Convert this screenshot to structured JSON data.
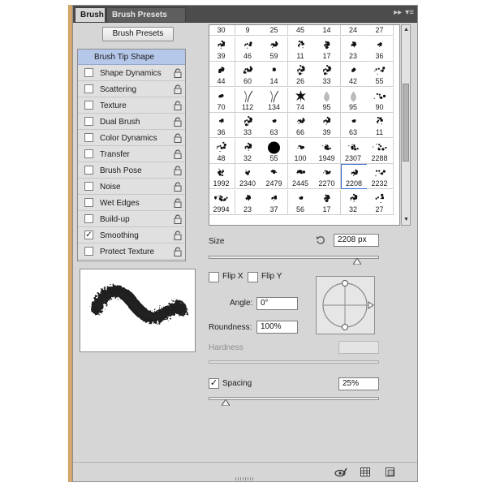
{
  "tabs": [
    {
      "label": "Brush",
      "active": true
    },
    {
      "label": "Brush Presets",
      "active": false
    }
  ],
  "panel_menu_icons": [
    "double-arrow-right-icon",
    "panel-menu-icon"
  ],
  "brush_presets_button": "Brush Presets",
  "options": [
    {
      "label": "Brush Tip Shape",
      "header": true
    },
    {
      "label": "Shape Dynamics",
      "checked": false
    },
    {
      "label": "Scattering",
      "checked": false
    },
    {
      "label": "Texture",
      "checked": false
    },
    {
      "label": "Dual Brush",
      "checked": false
    },
    {
      "label": "Color Dynamics",
      "checked": false
    },
    {
      "label": "Transfer",
      "checked": false
    },
    {
      "label": "Brush Pose",
      "checked": false
    },
    {
      "label": "Noise",
      "checked": false
    },
    {
      "label": "Wet Edges",
      "checked": false
    },
    {
      "label": "Build-up",
      "checked": false
    },
    {
      "label": "Smoothing",
      "checked": true
    },
    {
      "label": "Protect Texture",
      "checked": false
    }
  ],
  "brush_grid": [
    [
      "30",
      "9",
      "25",
      "45",
      "14",
      "24",
      "27"
    ],
    [
      "39",
      "46",
      "59",
      "11",
      "17",
      "23",
      "36"
    ],
    [
      "44",
      "60",
      "14",
      "26",
      "33",
      "42",
      "55"
    ],
    [
      "70",
      "112",
      "134",
      "74",
      "95",
      "95",
      "90"
    ],
    [
      "36",
      "33",
      "63",
      "66",
      "39",
      "63",
      "11"
    ],
    [
      "48",
      "32",
      "55",
      "100",
      "1949",
      "2307",
      "2288"
    ],
    [
      "1992",
      "2340",
      "2479",
      "2445",
      "2270",
      "2208",
      "2232"
    ],
    [
      "2994",
      "23",
      "37",
      "56",
      "17",
      "32",
      "27"
    ]
  ],
  "selected_brush": "2208",
  "size": {
    "label": "Size",
    "value": "2208 px"
  },
  "flip_x": {
    "label": "Flip X",
    "checked": false
  },
  "flip_y": {
    "label": "Flip Y",
    "checked": false
  },
  "angle": {
    "label": "Angle:",
    "value": "0°"
  },
  "roundness": {
    "label": "Roundness:",
    "value": "100%"
  },
  "hardness": {
    "label": "Hardness",
    "value": "",
    "disabled": true
  },
  "spacing": {
    "label": "Spacing",
    "checked": true,
    "value": "25%"
  },
  "sliders": {
    "size": 0.87,
    "hardness": 1.0,
    "spacing": 0.1
  },
  "bottom_icons": [
    "eye-brush-icon",
    "grid-icon",
    "new-preset-icon"
  ],
  "colors": {
    "tabbar": "#4c4c4c",
    "panel": "#d6d6d6",
    "header_highlight": "#b6c8ea",
    "selection": "#3b6fd6"
  }
}
